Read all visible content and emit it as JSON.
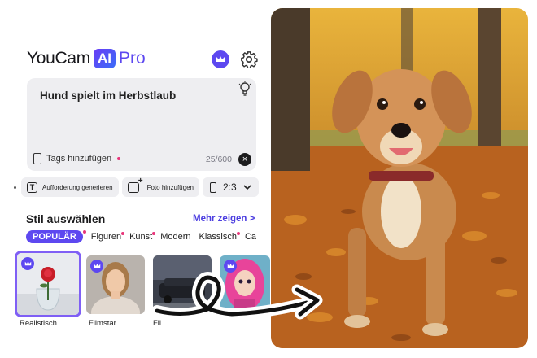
{
  "header": {
    "brand_name": "YouCam",
    "brand_ai": "AI",
    "brand_pro": "Pro"
  },
  "prompt": {
    "text": "Hund spielt im Herbstlaub",
    "tags_label": "Tags hinzufügen",
    "counter": "25/600",
    "clear_symbol": "×"
  },
  "actions": {
    "generate_prompt": "Aufforderung generieren",
    "add_photo": "Foto hinzufügen",
    "aspect_ratio": "2:3"
  },
  "styles": {
    "title": "Stil auswählen",
    "show_more": "Mehr zeigen >",
    "tabs": [
      "POPULÄR",
      "Figuren",
      "Kunst",
      "Modern",
      "Klassisch",
      "Ca"
    ],
    "selected_tab": "POPULÄR",
    "thumbnails": [
      {
        "label": "Realistisch",
        "selected": true
      },
      {
        "label": "Filmstar",
        "selected": false
      },
      {
        "label": "Fil",
        "selected": false
      },
      {
        "label": "",
        "selected": false
      }
    ]
  },
  "colors": {
    "accent": "#5d48f0",
    "link": "#4b3de0",
    "dot": "#e8357a",
    "panel": "#eeeef1"
  },
  "icons": [
    "crown-icon",
    "gear-icon",
    "lightbulb-icon",
    "tag-icon",
    "close-icon",
    "text-icon",
    "add-photo-icon",
    "phone-icon",
    "chevron-down-icon"
  ]
}
